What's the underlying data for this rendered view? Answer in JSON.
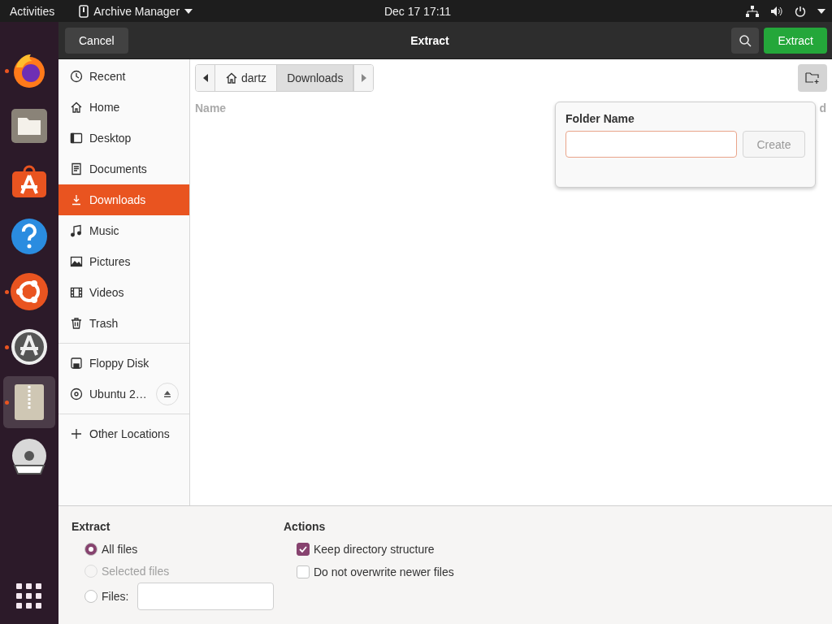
{
  "top_bar": {
    "activities": "Activities",
    "app_menu": "Archive Manager",
    "clock": "Dec 17  17:11"
  },
  "dock": {
    "apps": [
      {
        "kind": "firefox",
        "running": true,
        "selected": false
      },
      {
        "kind": "files",
        "running": false,
        "selected": false
      },
      {
        "kind": "software",
        "running": false,
        "selected": false
      },
      {
        "kind": "help",
        "running": false,
        "selected": false
      },
      {
        "kind": "ubuntu",
        "running": true,
        "selected": false
      },
      {
        "kind": "updater",
        "running": true,
        "selected": false
      },
      {
        "kind": "archive",
        "running": true,
        "selected": true
      },
      {
        "kind": "dvd",
        "running": false,
        "selected": false
      }
    ]
  },
  "header_bar": {
    "cancel": "Cancel",
    "title": "Extract",
    "extract": "Extract"
  },
  "sidebar": {
    "places": [
      {
        "kind": "recent",
        "label": "Recent",
        "selected": false
      },
      {
        "kind": "home",
        "label": "Home",
        "selected": false
      },
      {
        "kind": "desktop",
        "label": "Desktop",
        "selected": false
      },
      {
        "kind": "documents",
        "label": "Documents",
        "selected": false
      },
      {
        "kind": "downloads",
        "label": "Downloads",
        "selected": true
      },
      {
        "kind": "music",
        "label": "Music",
        "selected": false
      },
      {
        "kind": "pictures",
        "label": "Pictures",
        "selected": false
      },
      {
        "kind": "videos",
        "label": "Videos",
        "selected": false
      },
      {
        "kind": "trash",
        "label": "Trash",
        "selected": false
      }
    ],
    "devices": [
      {
        "kind": "floppy",
        "label": "Floppy Disk",
        "selected": false,
        "ejectable": false
      },
      {
        "kind": "disc",
        "label": "Ubuntu 2…",
        "selected": false,
        "ejectable": true
      }
    ],
    "other": {
      "label": "Other Locations"
    }
  },
  "path_bar": {
    "segments": [
      {
        "kind": "home",
        "label": "dartz",
        "selected": false
      },
      {
        "kind": "folder",
        "label": "Downloads",
        "selected": true
      }
    ]
  },
  "file_list": {
    "columns": [
      "Name",
      "d"
    ]
  },
  "new_folder_popover": {
    "title": "Folder Name",
    "create": "Create",
    "create_disabled": true
  },
  "options": {
    "extract": {
      "title": "Extract",
      "choices": [
        {
          "kind": "plain",
          "label": "All files",
          "selected": true,
          "disabled": false
        },
        {
          "kind": "plain",
          "label": "Selected files",
          "selected": false,
          "disabled": true
        },
        {
          "kind": "field",
          "label": "Files:",
          "selected": false,
          "disabled": false
        }
      ]
    },
    "actions": {
      "title": "Actions",
      "checks": [
        {
          "label": "Keep directory structure",
          "checked": true
        },
        {
          "label": "Do not overwrite newer files",
          "checked": false
        }
      ]
    }
  }
}
